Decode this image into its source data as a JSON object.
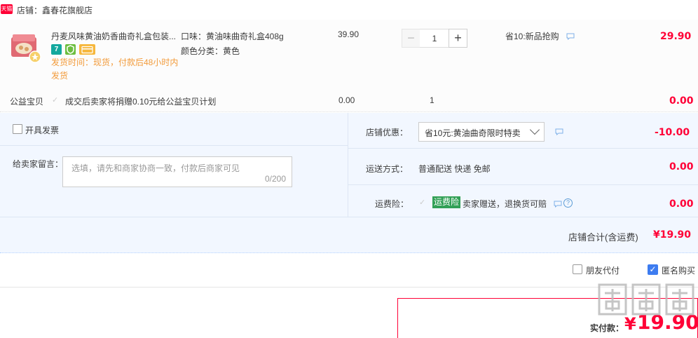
{
  "shop": {
    "label": "店铺：鑫春花旗舰店",
    "logo_text": "天猫"
  },
  "item": {
    "title": "丹麦风味黄油奶香曲奇礼盒包装...",
    "badges": {
      "seven": "7"
    },
    "ship_time": "发货时间：现货，付款后48小时内发货",
    "spec_taste": "口味：黄油味曲奇礼盒408g",
    "spec_color": "颜色分类：黄色",
    "unit_price": "39.90",
    "quantity": "1",
    "qty_minus": "−",
    "qty_plus": "+",
    "promo": "省10:新品抢购",
    "total": "29.90"
  },
  "charity": {
    "label": "公益宝贝",
    "text": "成交后卖家将捐赠0.10元给公益宝贝计划",
    "price": "0.00",
    "qty": "1",
    "total": "0.00"
  },
  "options": {
    "invoice_label": "开具发票",
    "message_label": "给卖家留言：",
    "message_placeholder": "选填，请先和商家协商一致，付款后商家可见",
    "message_counter": "0/200",
    "discount_label": "店铺优惠：",
    "discount_value": "省10元:黄油曲奇限时特卖",
    "discount_amount": "-10.00",
    "delivery_label": "运送方式：",
    "delivery_value": "普通配送 快递 免邮",
    "delivery_amount": "0.00",
    "insurance_label": "运费险：",
    "insurance_tag": "运费险",
    "insurance_text": "卖家赠送，退换货可赔",
    "insurance_amount": "0.00",
    "shop_total_label": "店铺合计(含运费)",
    "shop_total_value": "¥19.90"
  },
  "bottom": {
    "friend_pay_label": "朋友代付",
    "anonymous_label": "匿名购买",
    "pay_label": "实付款：",
    "pay_currency": "¥",
    "pay_amount": "19.90"
  },
  "colors": {
    "accent_red": "#ff0036",
    "ship_orange": "#f29b3b",
    "option_bg": "#f2f7ff",
    "check_blue": "#3d7cf0"
  },
  "icons": [
    "chat-icon",
    "help-icon",
    "minus-icon",
    "plus-icon",
    "checkbox-icon",
    "chevron-down-icon"
  ]
}
